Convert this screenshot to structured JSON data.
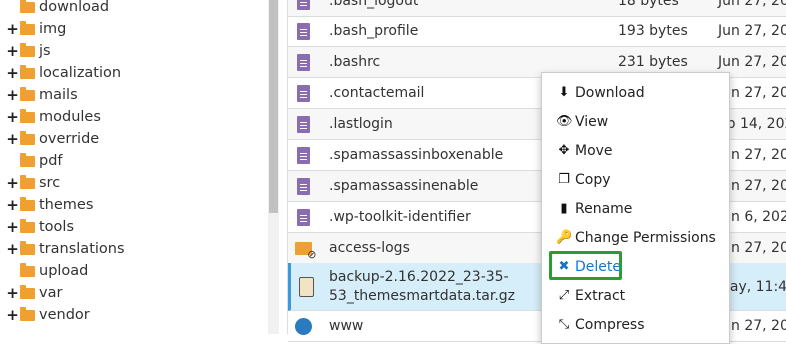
{
  "tree": {
    "items": [
      {
        "label": "download",
        "expandable": false
      },
      {
        "label": "img",
        "expandable": true
      },
      {
        "label": "js",
        "expandable": true
      },
      {
        "label": "localization",
        "expandable": true
      },
      {
        "label": "mails",
        "expandable": true
      },
      {
        "label": "modules",
        "expandable": true
      },
      {
        "label": "override",
        "expandable": true
      },
      {
        "label": "pdf",
        "expandable": false
      },
      {
        "label": "src",
        "expandable": true
      },
      {
        "label": "themes",
        "expandable": true
      },
      {
        "label": "tools",
        "expandable": true
      },
      {
        "label": "translations",
        "expandable": true
      },
      {
        "label": "upload",
        "expandable": false
      },
      {
        "label": "var",
        "expandable": true
      },
      {
        "label": "vendor",
        "expandable": true
      }
    ]
  },
  "files": {
    "rows": [
      {
        "name": ".bash_logout",
        "size": "18 bytes",
        "date": "Jun 27, 202",
        "icon": "document-icon"
      },
      {
        "name": ".bash_profile",
        "size": "193 bytes",
        "date": "Jun 27, 202",
        "icon": "document-icon"
      },
      {
        "name": ".bashrc",
        "size": "231 bytes",
        "date": "Jun 27, 202",
        "icon": "document-icon"
      },
      {
        "name": ".contactemail",
        "size": "",
        "date": "Jun 27, 202",
        "icon": "document-icon"
      },
      {
        "name": ".lastlogin",
        "size": "",
        "date": "eb 14, 202",
        "icon": "document-icon"
      },
      {
        "name": ".spamassassinboxenable",
        "size": "",
        "date": "Jun 27, 202",
        "icon": "document-icon"
      },
      {
        "name": ".spamassassinenable",
        "size": "",
        "date": "Jun 27, 202",
        "icon": "document-icon"
      },
      {
        "name": ".wp-toolkit-identifier",
        "size": "",
        "date": "Jun 6, 2021",
        "icon": "document-icon"
      },
      {
        "name": "access-logs",
        "size": "",
        "date": "Jun 27, 202",
        "icon": "folder-link-icon"
      },
      {
        "name": "backup-2.16.2022_23-35-",
        "name2": "53_themesmartdata.tar.gz",
        "size": "",
        "date": "day, 11:4",
        "icon": "archive-icon"
      },
      {
        "name": "www",
        "size": "",
        "date": "Jun 27, 202",
        "icon": "globe-icon"
      }
    ]
  },
  "context_menu": {
    "items": [
      {
        "label": "Download",
        "icon": "download-icon",
        "glyph": "⬇"
      },
      {
        "label": "View",
        "icon": "eye-icon",
        "glyph": "👁"
      },
      {
        "label": "Move",
        "icon": "move-icon",
        "glyph": "✥"
      },
      {
        "label": "Copy",
        "icon": "copy-icon",
        "glyph": "❐"
      },
      {
        "label": "Rename",
        "icon": "file-icon",
        "glyph": "▮"
      },
      {
        "label": "Change Permissions",
        "icon": "key-icon",
        "glyph": "🔑"
      },
      {
        "label": "Delete",
        "icon": "close-icon",
        "glyph": "✖"
      },
      {
        "label": "Extract",
        "icon": "expand-icon",
        "glyph": "⤢"
      },
      {
        "label": "Compress",
        "icon": "compress-icon",
        "glyph": "⤡"
      }
    ],
    "highlight_color": "#2d9c34",
    "delete_color": "#1a73c8"
  }
}
